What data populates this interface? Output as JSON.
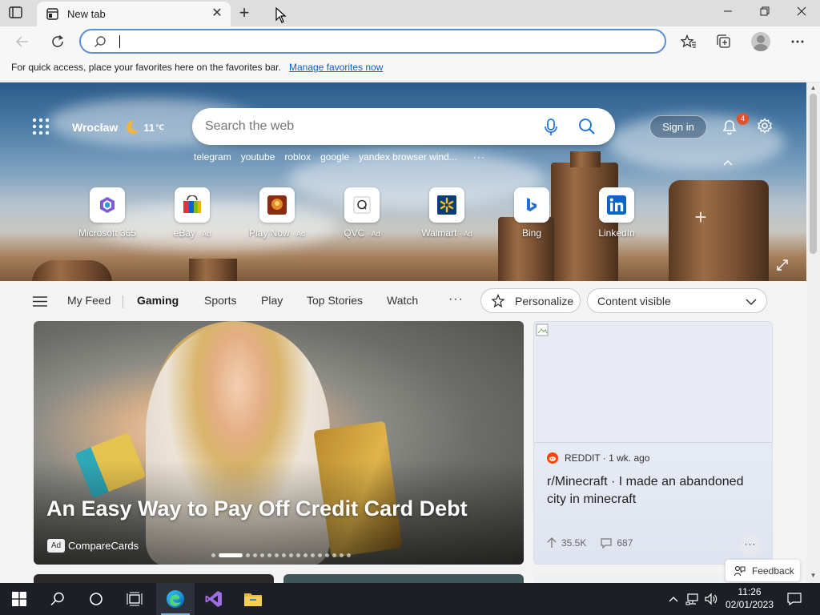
{
  "browser": {
    "tab": {
      "title": "New tab",
      "favicon": "new-tab-favicon"
    },
    "window_controls": [
      "minimize",
      "restore",
      "close"
    ],
    "address_bar": {
      "value": "",
      "placeholder": ""
    },
    "favorites_bar": {
      "message": "For quick access, place your favorites here on the favorites bar.",
      "link": "Manage favorites now"
    }
  },
  "hero": {
    "location": "Wrocław",
    "temperature": "11",
    "unit": "℃",
    "search_placeholder": "Search the web",
    "trending": [
      "telegram",
      "youtube",
      "roblox",
      "google",
      "yandex browser wind..."
    ],
    "trending_more": "···",
    "sign_in": "Sign in",
    "notification_count": "4",
    "tiles": [
      {
        "label": "Microsoft 365",
        "ad": "",
        "icon": "microsoft-365-icon"
      },
      {
        "label": "eBay",
        "ad": "· Ad",
        "icon": "ebay-icon"
      },
      {
        "label": "Play Now",
        "ad": "· Ad",
        "icon": "play-now-icon"
      },
      {
        "label": "QVC",
        "ad": "· Ad",
        "icon": "qvc-icon"
      },
      {
        "label": "Walmart",
        "ad": "· Ad",
        "icon": "walmart-icon"
      },
      {
        "label": "Bing",
        "ad": "",
        "icon": "bing-icon"
      },
      {
        "label": "LinkedIn",
        "ad": "",
        "icon": "linkedin-icon"
      }
    ]
  },
  "feed_nav": {
    "items": [
      "My Feed",
      "Gaming",
      "Sports",
      "Play",
      "Top Stories",
      "Watch"
    ],
    "active": "Gaming",
    "more": "···",
    "personalize": "Personalize",
    "content_visibility": "Content visible"
  },
  "main_card": {
    "headline": "An Easy Way to Pay Off Credit Card Debt",
    "ad_label": "Ad",
    "sponsor": "CompareCards",
    "slides_total": 17,
    "slide_active": 2
  },
  "side_card": {
    "source": "REDDIT · 1 wk. ago",
    "title": "r/Minecraft · I made an abandoned city in minecraft",
    "upvotes": "35.5K",
    "comments": "687",
    "more": "···"
  },
  "feedback": "Feedback",
  "taskbar": {
    "time": "11:26",
    "date": "02/01/2023"
  },
  "colors": {
    "accent": "#0f5fbd",
    "omnibox_border": "#5a8fd6",
    "badge": "#e0532c",
    "taskbar": "#1c1f26"
  }
}
